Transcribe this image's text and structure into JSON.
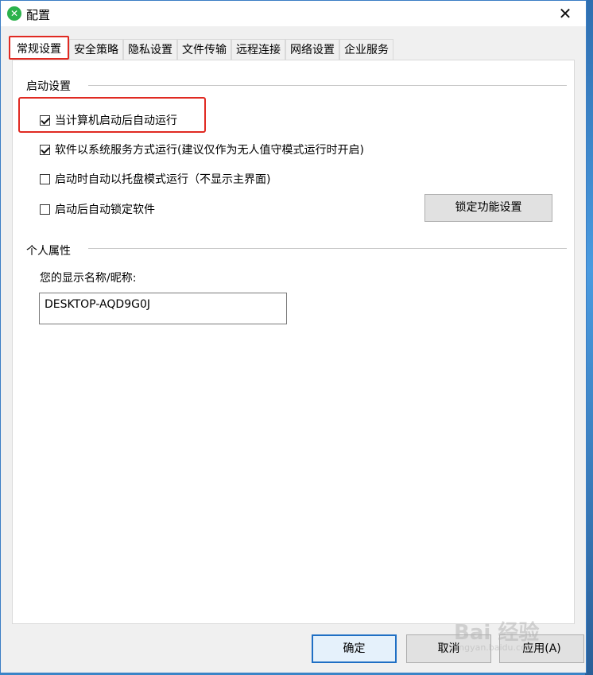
{
  "window": {
    "title": "配置",
    "close_glyph": "✕"
  },
  "tabs": [
    {
      "label": "常规设置",
      "active": true
    },
    {
      "label": "安全策略"
    },
    {
      "label": "隐私设置"
    },
    {
      "label": "文件传输"
    },
    {
      "label": "远程连接"
    },
    {
      "label": "网络设置"
    },
    {
      "label": "企业服务"
    }
  ],
  "startup": {
    "title": "启动设置",
    "options": [
      {
        "label": "当计算机启动后自动运行",
        "checked": true
      },
      {
        "label": "软件以系统服务方式运行(建议仅作为无人值守模式运行时开启)",
        "checked": true
      },
      {
        "label": "启动时自动以托盘模式运行（不显示主界面)",
        "checked": false
      },
      {
        "label": "启动后自动锁定软件",
        "checked": false
      }
    ],
    "lock_button": "锁定功能设置"
  },
  "personal": {
    "title": "个人属性",
    "name_label": "您的显示名称/昵称:",
    "name_value": "DESKTOP-AQD9G0J"
  },
  "footer": {
    "ok": "确定",
    "cancel": "取消",
    "apply": "应用(A)"
  },
  "watermark": {
    "text": "Bai 经验",
    "sub": "jingyan.baidu.com"
  },
  "colors": {
    "highlight": "#e02a22",
    "accent": "#1f6fc4"
  }
}
